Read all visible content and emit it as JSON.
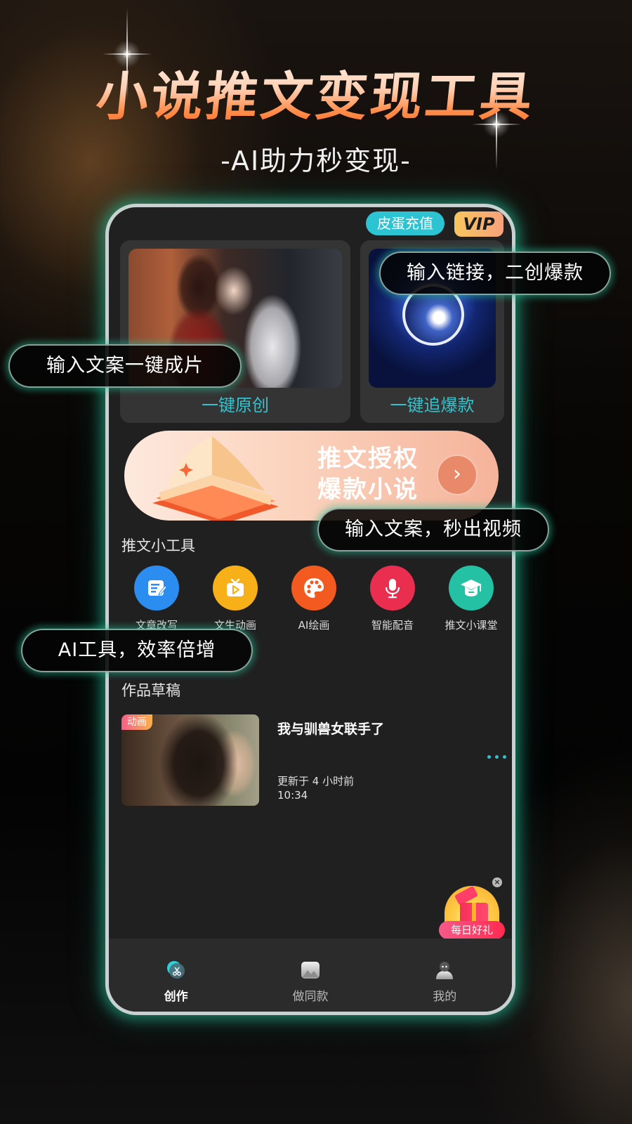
{
  "hero": {
    "title": "小说推文变现工具",
    "subtitle": "-AI助力秒变现-"
  },
  "app": {
    "topbar": {
      "recharge_label": "皮蛋充值",
      "vip_label": "VIP"
    },
    "features": [
      {
        "label": "一键原创",
        "image": "anime-couple-illustration"
      },
      {
        "label": "一键追爆款",
        "image": "eagle-logo-video-thumbnail"
      }
    ],
    "banner": {
      "line1": "推文授权",
      "line2": "爆款小说",
      "arrow": "›"
    },
    "tools_section": {
      "title": "推文小工具",
      "items": [
        {
          "label": "文章改写",
          "icon": "edit-document-icon",
          "color": "#2b8df0"
        },
        {
          "label": "文生动画",
          "icon": "tv-play-icon",
          "color": "#f7b018"
        },
        {
          "label": "AI绘画",
          "icon": "palette-icon",
          "color": "#f25a1f"
        },
        {
          "label": "智能配音",
          "icon": "microphone-icon",
          "color": "#ea2e4f"
        },
        {
          "label": "推文小课堂",
          "icon": "graduation-cap-icon",
          "color": "#25c1a4"
        }
      ]
    },
    "drafts_section": {
      "title": "作品草稿",
      "items": [
        {
          "badge": "动画",
          "title": "我与驯兽女联手了",
          "updated": "更新于 4 小时前",
          "time": "10:34"
        }
      ]
    },
    "gift": {
      "label": "每日好礼",
      "close": "×"
    },
    "tabbar": [
      {
        "label": "创作",
        "icon": "scissors-icon",
        "active": true
      },
      {
        "label": "做同款",
        "icon": "image-icon",
        "active": false
      },
      {
        "label": "我的",
        "icon": "profile-icon",
        "active": false
      }
    ]
  },
  "callouts": [
    "输入链接，二创爆款",
    "输入文案一键成片",
    "输入文案，秒出视频",
    "AI工具，效率倍增"
  ],
  "colors": {
    "accent_teal": "#36c2cc",
    "recharge_bg": "#2cc3d3",
    "phone_bg": "#202020",
    "glow": "#28be96"
  }
}
